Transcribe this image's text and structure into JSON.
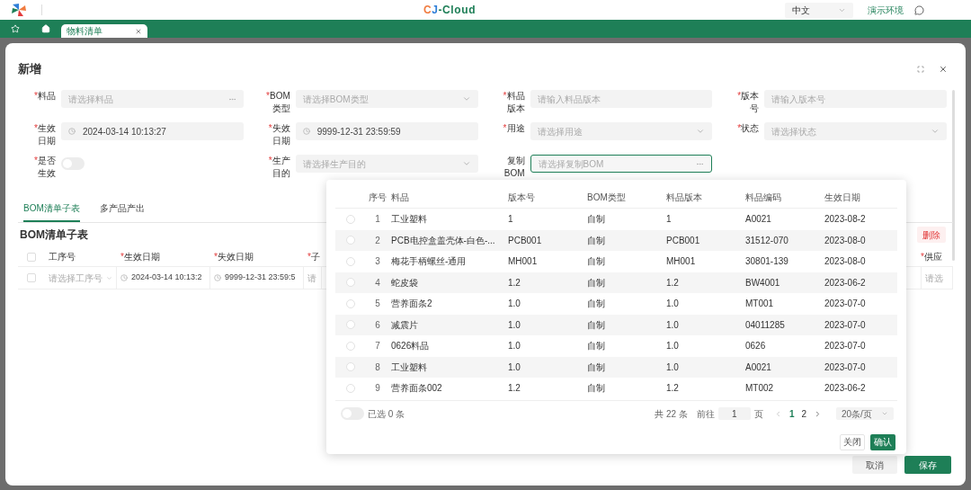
{
  "header": {
    "logo": [
      {
        "text": "C",
        "color": "#f07b3f"
      },
      {
        "text": "J",
        "color": "#2f7fd8"
      },
      {
        "text": "-Cloud",
        "color": "#1e7f57"
      }
    ],
    "language": "中文",
    "environment": "演示环境"
  },
  "tabs": [
    {
      "label": "物料清单",
      "selected": true
    }
  ],
  "dialog": {
    "title": "新增",
    "required_mark": "*",
    "fields": [
      {
        "label": "料品",
        "required": true,
        "kind": "lookup",
        "placeholder": "请选择料品",
        "focused": false
      },
      {
        "label": "BOM类型",
        "required": true,
        "kind": "select",
        "placeholder": "请选择BOM类型",
        "focused": false
      },
      {
        "label": "料品版本",
        "required": true,
        "kind": "input",
        "placeholder": "请输入料品版本",
        "focused": false
      },
      {
        "label": "版本号",
        "required": true,
        "kind": "input",
        "placeholder": "请输入版本号",
        "focused": false
      },
      {
        "label": "生效日期",
        "required": true,
        "kind": "date",
        "value": "2024-03-14 10:13:27",
        "focused": false
      },
      {
        "label": "失效日期",
        "required": true,
        "kind": "date",
        "value": "9999-12-31 23:59:59",
        "focused": false
      },
      {
        "label": "用途",
        "required": true,
        "kind": "select",
        "placeholder": "请选择用途",
        "focused": false
      },
      {
        "label": "状态",
        "required": true,
        "kind": "select",
        "placeholder": "请选择状态",
        "focused": false
      },
      {
        "label": "是否生效",
        "required": true,
        "kind": "switch",
        "on": false
      },
      {
        "label": "生产目的",
        "required": true,
        "kind": "select",
        "placeholder": "请选择生产目的",
        "focused": false
      },
      {
        "label": "复制BOM",
        "required": false,
        "kind": "lookup",
        "placeholder": "请选择复制BOM",
        "focused": true
      }
    ],
    "sub_tabs": [
      {
        "label": "BOM清单子表",
        "selected": true
      },
      {
        "label": "多产品产出",
        "selected": false
      }
    ],
    "subtable": {
      "title": "BOM清单子表",
      "delete_button": "删除",
      "all_checked": false,
      "columns": [
        {
          "label": "工序号",
          "required": false
        },
        {
          "label": "生效日期",
          "required": true
        },
        {
          "label": "失效日期",
          "required": true
        },
        {
          "label": "子",
          "required": true
        },
        {
          "label": "供应",
          "required": true
        }
      ],
      "rows": [
        {
          "checked": false,
          "cells": [
            {
              "kind": "select",
              "placeholder": "请选择工序号"
            },
            {
              "kind": "date",
              "value": "2024-03-14 10:13:2"
            },
            {
              "kind": "date",
              "value": "9999-12-31 23:59:5"
            },
            {
              "kind": "input",
              "placeholder": "请"
            },
            {
              "kind": "input",
              "placeholder": "请选"
            }
          ]
        }
      ]
    },
    "buttons": {
      "cancel": "取消",
      "save": "保存"
    },
    "picker": {
      "columns": [
        "序号",
        "料品",
        "版本号",
        "BOM类型",
        "料品版本",
        "料品编码",
        "生效日期"
      ],
      "rows": [
        {
          "selected": false,
          "cells": [
            "1",
            "工业塑料",
            "1",
            "自制",
            "1",
            "A0021",
            "2023-08-2"
          ]
        },
        {
          "selected": false,
          "cells": [
            "2",
            "PCB电控盒盖壳体-白色-...",
            "PCB001",
            "自制",
            "PCB001",
            "31512-070",
            "2023-08-0"
          ]
        },
        {
          "selected": false,
          "cells": [
            "3",
            "梅花手柄螺丝-通用",
            "MH001",
            "自制",
            "MH001",
            "30801-139",
            "2023-08-0"
          ]
        },
        {
          "selected": false,
          "cells": [
            "4",
            "蛇皮袋",
            "1.2",
            "自制",
            "1.2",
            "BW4001",
            "2023-06-2"
          ]
        },
        {
          "selected": false,
          "cells": [
            "5",
            "营养面条2",
            "1.0",
            "自制",
            "1.0",
            "MT001",
            "2023-07-0"
          ]
        },
        {
          "selected": false,
          "cells": [
            "6",
            "减震片",
            "1.0",
            "自制",
            "1.0",
            "04011285",
            "2023-07-0"
          ]
        },
        {
          "selected": false,
          "cells": [
            "7",
            "0626料品",
            "1.0",
            "自制",
            "1.0",
            "0626",
            "2023-07-0"
          ]
        },
        {
          "selected": false,
          "cells": [
            "8",
            "工业塑料",
            "1.0",
            "自制",
            "1.0",
            "A0021",
            "2023-07-0"
          ]
        },
        {
          "selected": false,
          "cells": [
            "9",
            "营养面条002",
            "1.2",
            "自制",
            "1.2",
            "MT002",
            "2023-06-2"
          ]
        }
      ],
      "only_selected": false,
      "selected_count": "已选 0 条",
      "total": "共 22 条",
      "goto_label": "前往",
      "goto_value": "1",
      "page_unit": "页",
      "pages": [
        {
          "label": "1",
          "selected": true
        },
        {
          "label": "2",
          "selected": false
        }
      ],
      "page_size": "20条/页",
      "close": "关闭",
      "confirm": "确认"
    }
  }
}
